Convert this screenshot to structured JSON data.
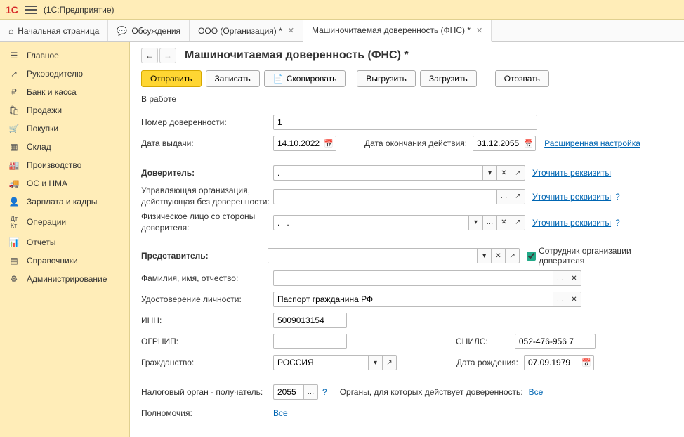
{
  "titlebar": {
    "app_name": "(1С:Предприятие)"
  },
  "tabs": {
    "home": "Начальная страница",
    "discussions": "Обсуждения",
    "org": "ООО (Организация) *",
    "poa": "Машиночитаемая доверенность (ФНС) *"
  },
  "sidebar": {
    "items": [
      {
        "label": "Главное"
      },
      {
        "label": "Руководителю"
      },
      {
        "label": "Банк и касса"
      },
      {
        "label": "Продажи"
      },
      {
        "label": "Покупки"
      },
      {
        "label": "Склад"
      },
      {
        "label": "Производство"
      },
      {
        "label": "ОС и НМА"
      },
      {
        "label": "Зарплата и кадры"
      },
      {
        "label": "Операции"
      },
      {
        "label": "Отчеты"
      },
      {
        "label": "Справочники"
      },
      {
        "label": "Администрирование"
      }
    ]
  },
  "page": {
    "title": "Машиночитаемая доверенность (ФНС) *",
    "toolbar": {
      "send": "Отправить",
      "save": "Записать",
      "copy": "Скопировать",
      "export": "Выгрузить",
      "import": "Загрузить",
      "revoke": "Отозвать"
    },
    "status": "В работе",
    "labels": {
      "number": "Номер доверенности:",
      "issue_date": "Дата выдачи:",
      "end_date": "Дата окончания действия:",
      "ext_settings": "Расширенная настройка",
      "principal": "Доверитель:",
      "managing_org": "Управляющая организация, действующая без доверенности:",
      "principal_person": "Физическое лицо со стороны доверителя:",
      "clarify": "Уточнить реквизиты",
      "representative": "Представитель:",
      "employee_of_principal": "Сотрудник организации доверителя",
      "fio": "Фамилия, имя, отчество:",
      "id_doc": "Удостоверение личности:",
      "inn": "ИНН:",
      "ogrnip": "ОГРНИП:",
      "snils": "СНИЛС:",
      "citizenship": "Гражданство:",
      "birth_date": "Дата рождения:",
      "tax_authority": "Налоговый орган - получатель:",
      "authorities_for": "Органы, для которых действует доверенность:",
      "all": "Все",
      "powers": "Полномочия:"
    },
    "values": {
      "number": "1",
      "issue_date": "14.10.2022",
      "end_date": "31.12.2055",
      "principal": ".",
      "managing_org": "",
      "principal_person": ".   .",
      "representative": "",
      "fio": "",
      "id_doc": "Паспорт гражданина РФ",
      "inn": "5009013154",
      "ogrnip": "",
      "snils": "052-476-956 7",
      "citizenship": "РОССИЯ",
      "birth_date": "07.09.1979",
      "tax_authority": "2055",
      "employee_checked": true
    }
  }
}
